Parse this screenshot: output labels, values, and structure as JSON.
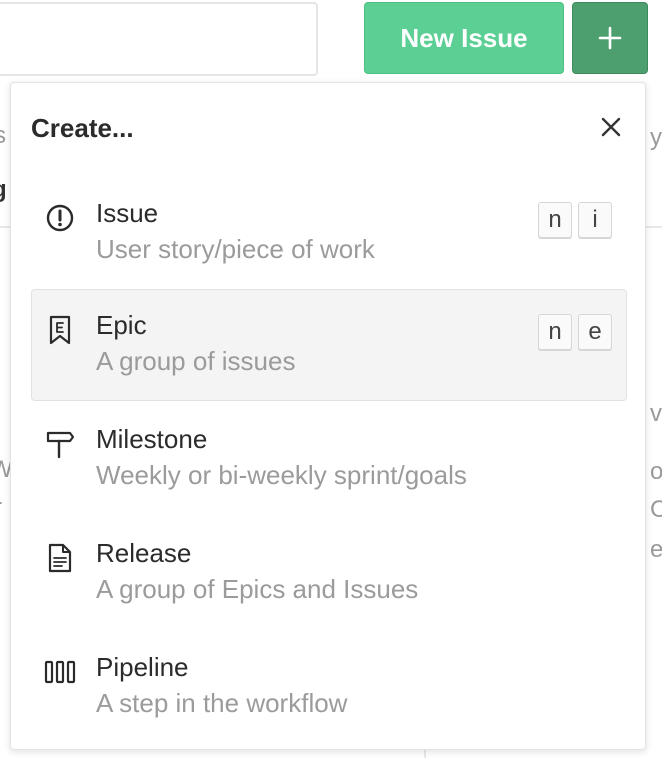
{
  "toolbar": {
    "new_issue_label": "New Issue",
    "plus_label": "+",
    "primary_color": "#5ccf94",
    "secondary_color": "#4e9f6f"
  },
  "background_fragments": {
    "left": [
      "s",
      "g",
      "W",
      "r"
    ],
    "right": [
      "y",
      "v",
      "o",
      "C",
      "e"
    ]
  },
  "dropdown": {
    "title": "Create...",
    "close_icon": "close-icon",
    "items": [
      {
        "icon": "exclamation-circle-icon",
        "title": "Issue",
        "description": "User story/piece of work",
        "shortcut": [
          "n",
          "i"
        ],
        "highlighted": false
      },
      {
        "icon": "epic-bookmark-icon",
        "title": "Epic",
        "description": "A group of issues",
        "shortcut": [
          "n",
          "e"
        ],
        "highlighted": true
      },
      {
        "icon": "signpost-icon",
        "title": "Milestone",
        "description": "Weekly or bi-weekly sprint/goals",
        "shortcut": [],
        "highlighted": false
      },
      {
        "icon": "document-icon",
        "title": "Release",
        "description": "A group of Epics and Issues",
        "shortcut": [],
        "highlighted": false
      },
      {
        "icon": "pipeline-columns-icon",
        "title": "Pipeline",
        "description": "A step in the workflow",
        "shortcut": [],
        "highlighted": false
      }
    ]
  }
}
